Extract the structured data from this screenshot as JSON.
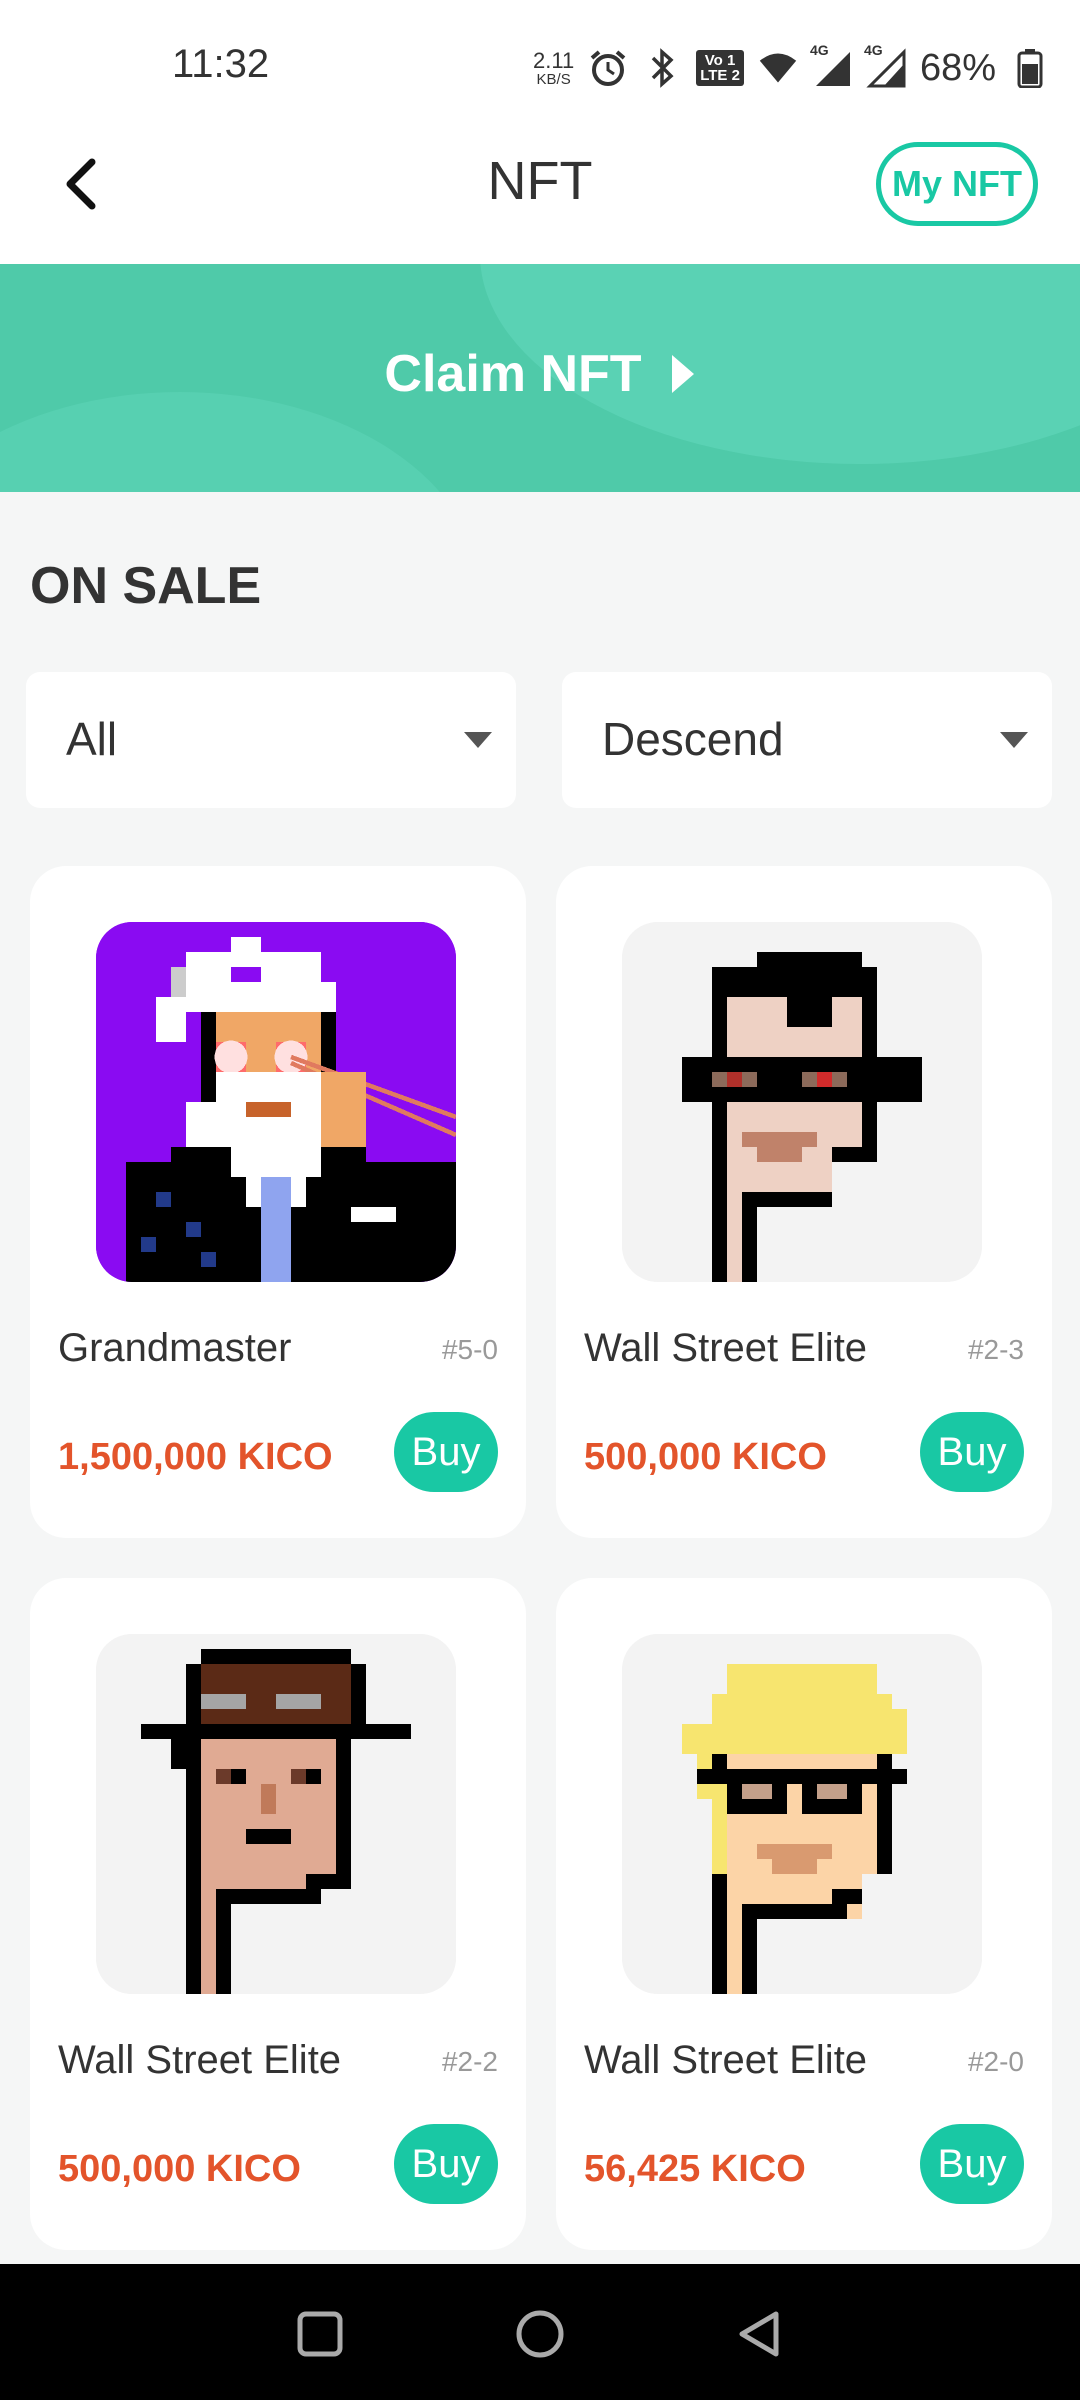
{
  "status_bar": {
    "time": "11:32",
    "net_speed_value": "2.11",
    "net_speed_unit": "KB/S",
    "lte_label_top": "Vo 1",
    "lte_label_bottom": "LTE 2",
    "sim1_label": "4G",
    "sim2_label": "4G",
    "battery_percent": "68%",
    "icons": [
      "alarm-icon",
      "bluetooth-icon",
      "volte-icon",
      "wifi-icon",
      "signal-icon",
      "signal-icon",
      "battery-icon"
    ]
  },
  "header": {
    "title": "NFT",
    "my_nft_label": "My NFT"
  },
  "banner": {
    "cta_label": "Claim NFT"
  },
  "section": {
    "title": "ON SALE"
  },
  "filters": {
    "category_value": "All",
    "sort_value": "Descend"
  },
  "items": [
    {
      "name": "Grandmaster",
      "serial": "#5-0",
      "price": "1,500,000 KICO",
      "buy_label": "Buy"
    },
    {
      "name": "Wall Street Elite",
      "serial": "#2-3",
      "price": "500,000 KICO",
      "buy_label": "Buy"
    },
    {
      "name": "Wall Street Elite",
      "serial": "#2-2",
      "price": "500,000 KICO",
      "buy_label": "Buy"
    },
    {
      "name": "Wall Street Elite",
      "serial": "#2-0",
      "price": "56,425 KICO",
      "buy_label": "Buy"
    }
  ],
  "colors": {
    "accent": "#19c8a4",
    "banner": "#4fcaa9",
    "price": "#e3542b"
  }
}
